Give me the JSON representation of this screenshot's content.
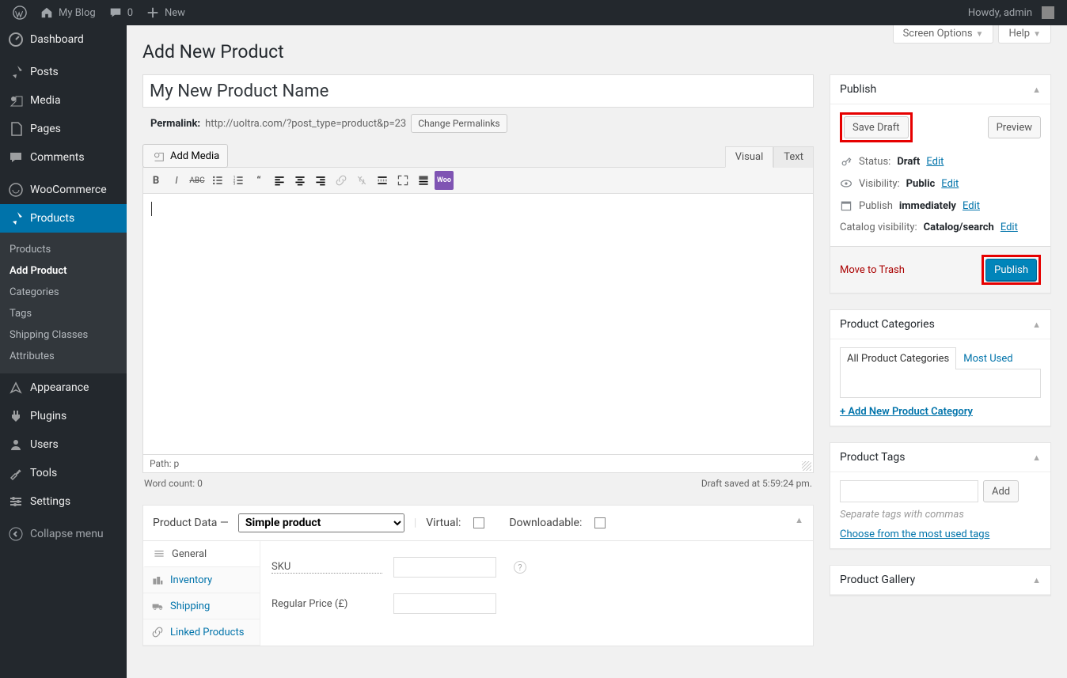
{
  "adminbar": {
    "site_name": "My Blog",
    "comments_count": "0",
    "new_label": "New",
    "howdy": "Howdy, admin"
  },
  "screen_meta": {
    "screen_options": "Screen Options",
    "help": "Help"
  },
  "sidebar": {
    "items": [
      {
        "label": "Dashboard"
      },
      {
        "label": "Posts"
      },
      {
        "label": "Media"
      },
      {
        "label": "Pages"
      },
      {
        "label": "Comments"
      },
      {
        "label": "WooCommerce"
      },
      {
        "label": "Products"
      },
      {
        "label": "Appearance"
      },
      {
        "label": "Plugins"
      },
      {
        "label": "Users"
      },
      {
        "label": "Tools"
      },
      {
        "label": "Settings"
      }
    ],
    "submenu": [
      {
        "label": "Products"
      },
      {
        "label": "Add Product"
      },
      {
        "label": "Categories"
      },
      {
        "label": "Tags"
      },
      {
        "label": "Shipping Classes"
      },
      {
        "label": "Attributes"
      }
    ],
    "collapse": "Collapse menu"
  },
  "page": {
    "title": "Add New Product"
  },
  "post": {
    "title_value": "My New Product Name",
    "permalink_label": "Permalink:",
    "permalink_url": "http://uoltra.com/?post_type=product&p=23",
    "change_permalinks": "Change Permalinks"
  },
  "editor": {
    "add_media": "Add Media",
    "tab_visual": "Visual",
    "tab_text": "Text",
    "path_label": "Path:",
    "path_value": "p",
    "word_count_label": "Word count: 0",
    "draft_saved": "Draft saved at 5:59:24 pm."
  },
  "publish": {
    "box_title": "Publish",
    "save_draft": "Save Draft",
    "preview": "Preview",
    "status_label": "Status:",
    "status_value": "Draft",
    "visibility_label": "Visibility:",
    "visibility_value": "Public",
    "publish_label": "Publish",
    "publish_value": "immediately",
    "catalog_label": "Catalog visibility:",
    "catalog_value": "Catalog/search",
    "edit": "Edit",
    "move_trash": "Move to Trash",
    "publish_btn": "Publish"
  },
  "categories": {
    "box_title": "Product Categories",
    "tab_all": "All Product Categories",
    "tab_most": "Most Used",
    "add_new": "+ Add New Product Category"
  },
  "tags": {
    "box_title": "Product Tags",
    "add_btn": "Add",
    "hint": "Separate tags with commas",
    "choose": "Choose from the most used tags"
  },
  "gallery": {
    "box_title": "Product Gallery"
  },
  "product_data": {
    "title": "Product Data —",
    "select_value": "Simple product",
    "virtual": "Virtual:",
    "downloadable": "Downloadable:",
    "tabs": {
      "general": "General",
      "inventory": "Inventory",
      "shipping": "Shipping",
      "linked": "Linked Products"
    },
    "sku_label": "SKU",
    "regular_price_label": "Regular Price (£)"
  }
}
